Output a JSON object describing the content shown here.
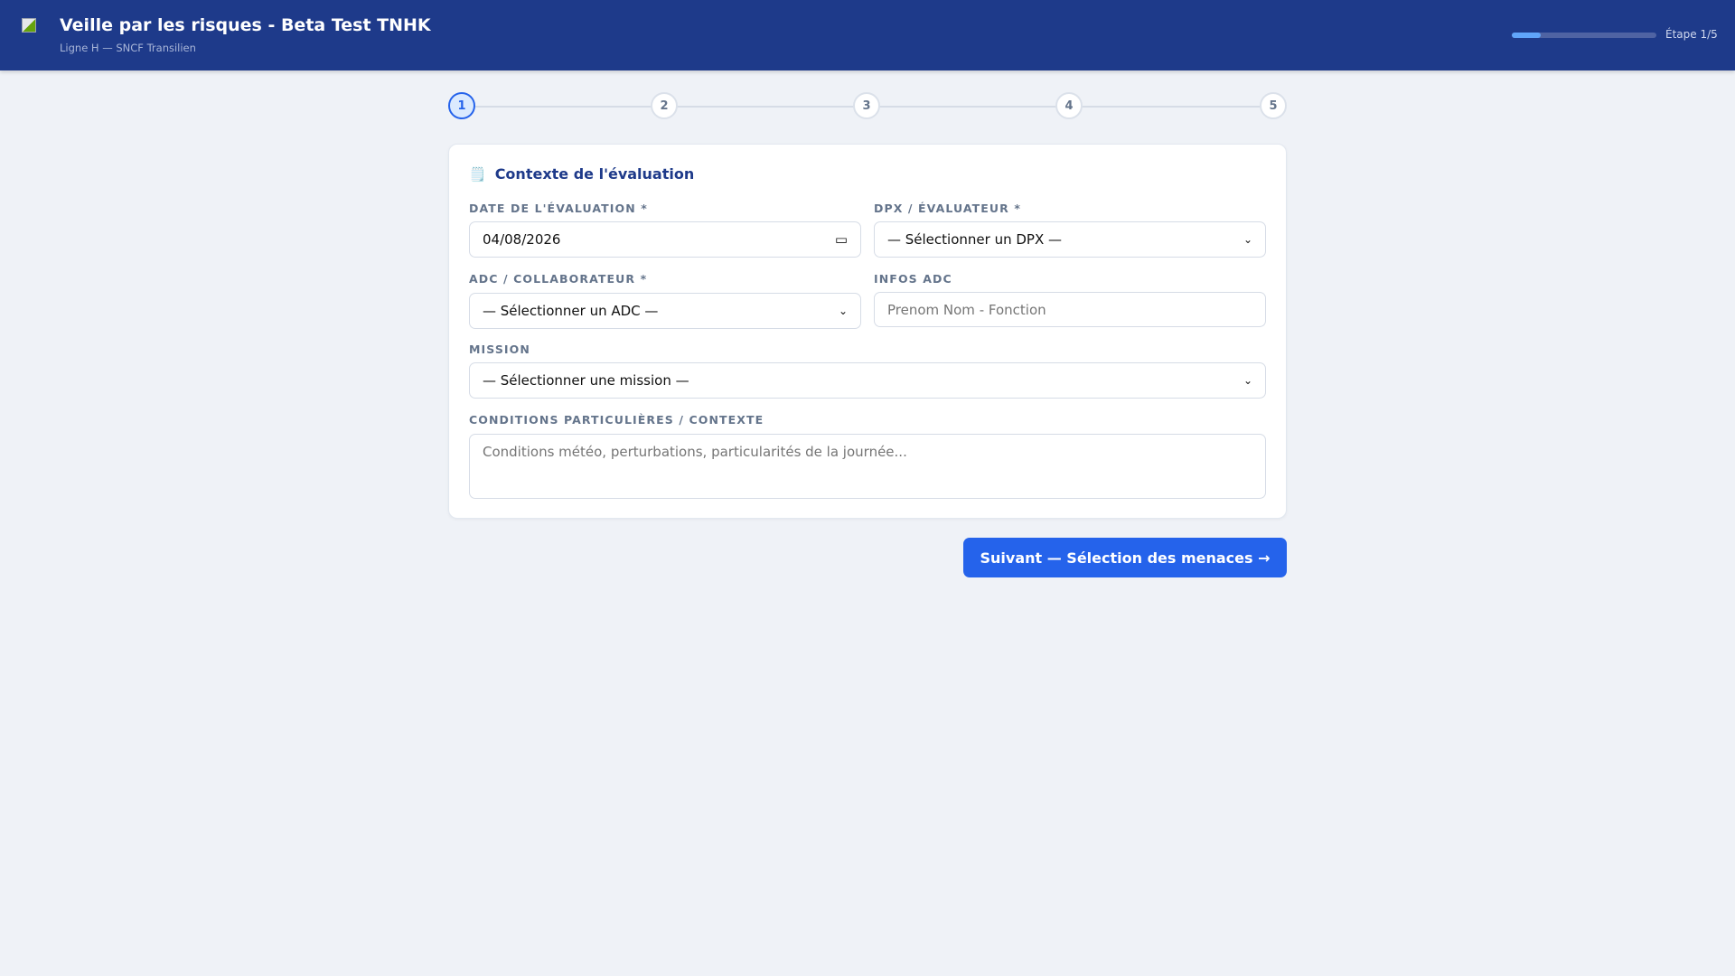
{
  "header": {
    "title": "Veille par les risques - Beta Test TNHK",
    "subtitle": "Ligne H — SNCF Transilien",
    "progress_percent": 20,
    "step_label": "Étape 1/5"
  },
  "steps": [
    "1",
    "2",
    "3",
    "4",
    "5"
  ],
  "card": {
    "icon": "🗒️",
    "title": "Contexte de l'évaluation",
    "date_label": "DATE DE L'ÉVALUATION *",
    "date_value": "04/08/2026",
    "dpx_label": "DPX / ÉVALUATEUR *",
    "dpx_value": "— Sélectionner un DPX —",
    "adc_label": "ADC / COLLABORATEUR *",
    "adc_value": "— Sélectionner un ADC —",
    "infos_label": "INFOS ADC",
    "infos_placeholder": "Prenom Nom - Fonction",
    "mission_label": "MISSION",
    "mission_value": "— Sélectionner une mission —",
    "conditions_label": "CONDITIONS PARTICULIÈRES / CONTEXTE",
    "conditions_placeholder": "Conditions météo, perturbations, particularités de la journée..."
  },
  "next_button": "Suivant — Sélection des menaces →",
  "colors": {
    "header": "#1e3a8a",
    "accent": "#2563eb"
  }
}
